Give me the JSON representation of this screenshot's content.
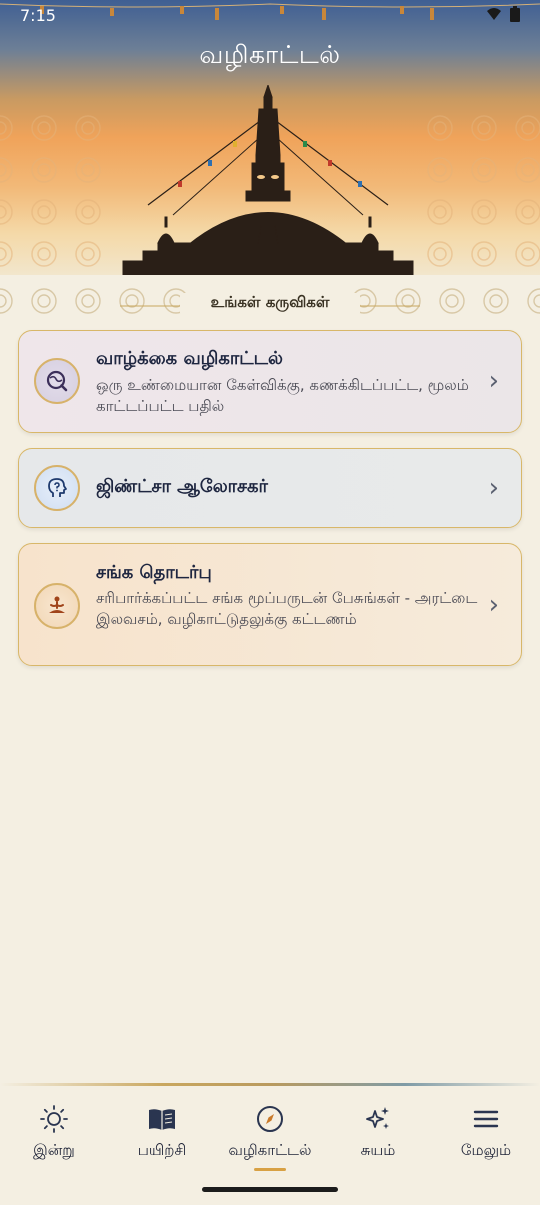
{
  "status_bar": {
    "time": "7:15"
  },
  "header": {
    "title": "வழிகாட்டல்"
  },
  "section": {
    "title": "உங்கள் கருவிகள்"
  },
  "cards": [
    {
      "title": "வாழ்க்கை வழிகாட்டல்",
      "description": "ஒரு உண்மையான கேள்விக்கு, கணக்கிடப்பட்ட, மூலம் காட்டப்பட்ட பதில்",
      "icon": "life-guidance-icon"
    },
    {
      "title": "ஜிண்ட்சா ஆலோசகர்",
      "description": "",
      "icon": "zen-advisor-icon"
    },
    {
      "title": "சங்க தொடர்பு",
      "description": "சரிபார்க்கப்பட்ட சங்க மூப்பருடன் பேசுங்கள் - அரட்டை இலவசம், வழிகாட்டுதலுக்கு கட்டணம்",
      "icon": "meditation-icon"
    }
  ],
  "bottom_nav": {
    "items": [
      {
        "label": "இன்று",
        "icon": "sun-icon"
      },
      {
        "label": "பயிற்சி",
        "icon": "book-icon"
      },
      {
        "label": "வழிகாட்டல்",
        "icon": "compass-icon",
        "active": true
      },
      {
        "label": "சுயம்",
        "icon": "sparkle-icon"
      },
      {
        "label": "மேலும்",
        "icon": "menu-icon"
      }
    ]
  },
  "colors": {
    "accent_gold": "#d8b769",
    "background": "#f4efe2",
    "text_primary": "#1e2640",
    "nav_active": "#d8a144"
  }
}
